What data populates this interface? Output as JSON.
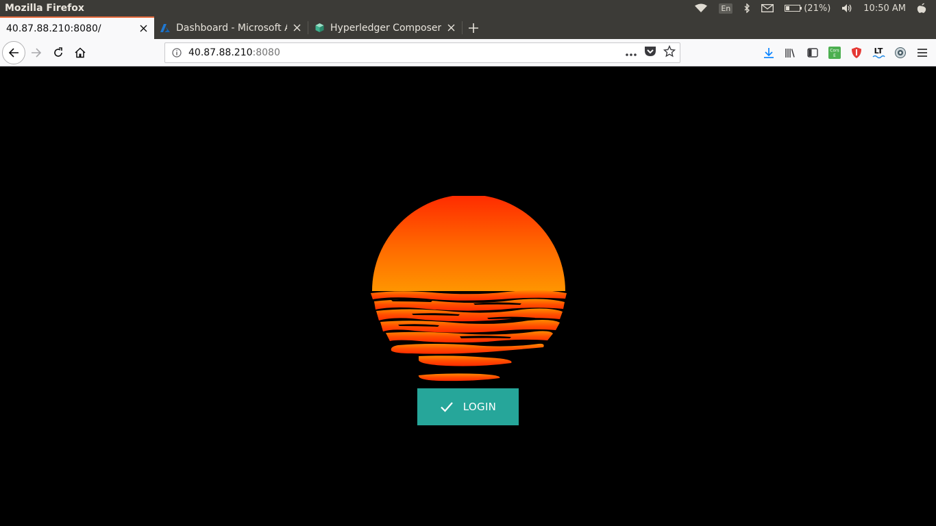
{
  "system_bar": {
    "app_title": "Mozilla Firefox",
    "keyboard_layout": "En",
    "battery_percent": "(21%)",
    "clock": "10:50 AM",
    "icons": [
      "wifi-icon",
      "bluetooth-icon",
      "mail-icon",
      "battery-icon",
      "volume-icon",
      "power-icon"
    ]
  },
  "tabs": [
    {
      "label": "40.87.88.210:8080/",
      "active": true,
      "favicon": "none"
    },
    {
      "label": "Dashboard - Microsoft A",
      "active": false,
      "favicon": "azure-icon"
    },
    {
      "label": "Hyperledger Composer",
      "active": false,
      "favicon": "cube-icon"
    }
  ],
  "navbar": {
    "url_host": "40.87.88.210",
    "url_port": ":8080",
    "icons": [
      "back-icon",
      "forward-icon",
      "reload-icon",
      "home-icon",
      "site-info-icon",
      "page-actions-icon",
      "pocket-icon",
      "bookmark-star-icon",
      "download-icon",
      "library-icon",
      "sidebar-icon",
      "cors-extension-icon",
      "shield-extension-icon",
      "languagetool-icon",
      "ghostery-icon",
      "menu-icon"
    ],
    "cors_label": "Cors E",
    "lt_label": "LT"
  },
  "page": {
    "login_label": "LOGIN",
    "colors": {
      "button": "#26a69a",
      "background": "#000000",
      "sun_top": "#ff3300",
      "sun_bottom": "#ff8c00"
    }
  }
}
